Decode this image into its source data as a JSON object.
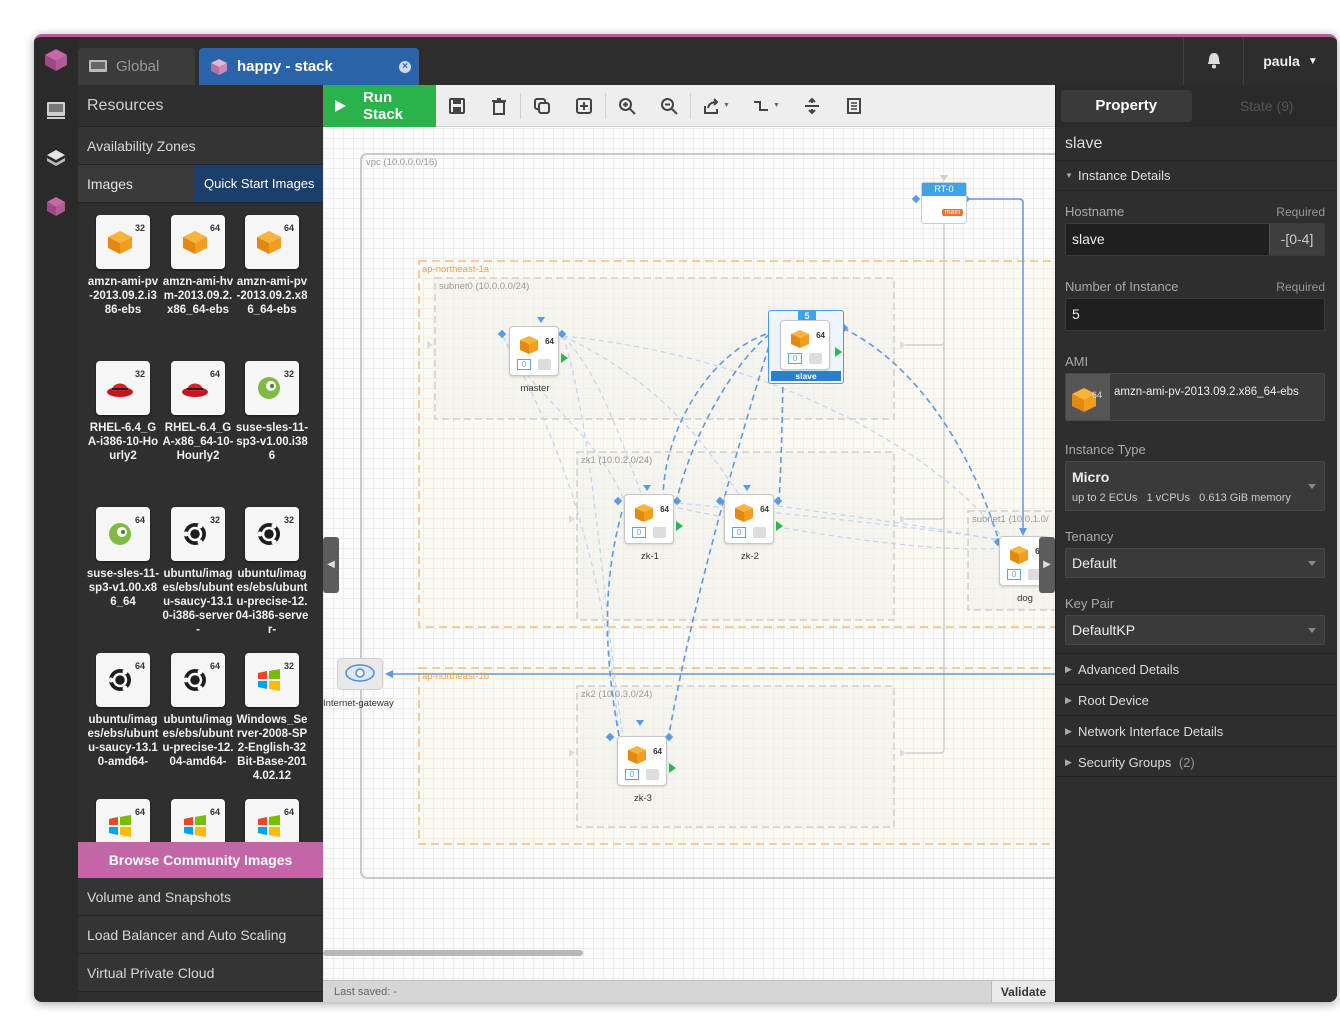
{
  "tabs": {
    "global": "Global",
    "stack": "happy - stack"
  },
  "user": {
    "name": "paula"
  },
  "resources": {
    "title": "Resources",
    "availability_zones": "Availability Zones",
    "images_tab": "Images",
    "quick_start": "Quick Start Images",
    "amis": [
      {
        "name": "amzn-ami-pv-2013.09.2.i386-ebs",
        "bits": "32",
        "icon": "amazon-box-icon"
      },
      {
        "name": "amzn-ami-hvm-2013.09.2.x86_64-ebs",
        "bits": "64",
        "icon": "amazon-box-icon"
      },
      {
        "name": "amzn-ami-pv-2013.09.2.x86_64-ebs",
        "bits": "64",
        "icon": "amazon-box-icon"
      },
      {
        "name": "RHEL-6.4_GA-i386-10-Hourly2",
        "bits": "32",
        "icon": "redhat-icon"
      },
      {
        "name": "RHEL-6.4_GA-x86_64-10-Hourly2",
        "bits": "64",
        "icon": "redhat-icon"
      },
      {
        "name": "suse-sles-11-sp3-v1.00.i386",
        "bits": "32",
        "icon": "suse-icon"
      },
      {
        "name": "suse-sles-11-sp3-v1.00.x86_64",
        "bits": "64",
        "icon": "suse-icon"
      },
      {
        "name": "ubuntu/images/ebs/ubuntu-saucy-13.10-i386-server-",
        "bits": "32",
        "icon": "ubuntu-icon"
      },
      {
        "name": "ubuntu/images/ebs/ubuntu-precise-12.04-i386-server-",
        "bits": "32",
        "icon": "ubuntu-icon"
      },
      {
        "name": "ubuntu/images/ebs/ubuntu-saucy-13.10-amd64-",
        "bits": "64",
        "icon": "ubuntu-icon"
      },
      {
        "name": "ubuntu/images/ebs/ubuntu-precise-12.04-amd64-",
        "bits": "64",
        "icon": "ubuntu-icon"
      },
      {
        "name": "Windows_Server-2008-SP2-English-32Bit-Base-2014.02.12",
        "bits": "32",
        "icon": "windows-icon"
      },
      {
        "name": "",
        "bits": "64",
        "icon": "windows-icon"
      },
      {
        "name": "",
        "bits": "64",
        "icon": "windows-icon"
      },
      {
        "name": "",
        "bits": "64",
        "icon": "windows-icon"
      }
    ],
    "browse_community": "Browse Community Images",
    "volume": "Volume and Snapshots",
    "load_balancer": "Load Balancer and Auto Scaling",
    "vpc": "Virtual Private Cloud"
  },
  "toolbar": {
    "run_stack": "Run Stack"
  },
  "diagram": {
    "vpc": "vpc (10.0.0.0/16)",
    "az_a": "ap-northeast-1a",
    "az_b": "ap-northeast-1b",
    "subnet0": "subnet0 (10.0.0.0/24)",
    "zk1": "zk1 (10.0.2.0/24)",
    "zk2": "zk2 (10.0.3.0/24)",
    "subnet1": "subnet1 (10.0.1.0/",
    "route_table": "RT-0",
    "route_main": "main",
    "igw": "Internet-gateway",
    "instances": {
      "master": "master",
      "slave": "slave",
      "slave_count": "5",
      "zk1": "zk-1",
      "zk2": "zk-2",
      "zk3": "zk-3",
      "dog": "dog",
      "bits": "64",
      "eni": "0"
    }
  },
  "status": {
    "last_saved": "Last saved: -",
    "validate": "Validate"
  },
  "properties": {
    "tab_property": "Property",
    "tab_state": "State (9)",
    "title": "slave",
    "instance_details": "Instance Details",
    "hostname_label": "Hostname",
    "required": "Required",
    "hostname": "slave",
    "hostname_suffix": "-[0-4]",
    "count_label": "Number of Instance",
    "count": "5",
    "ami_label": "AMI",
    "ami_value": "amzn-ami-pv-2013.09.2.x86_64-ebs",
    "ami_bits": "64",
    "type_label": "Instance Type",
    "type_value": "Micro",
    "type_ecus": "up to 2 ECUs",
    "type_vcpus": "1 vCPUs",
    "type_memory": "0.613 GiB memory",
    "tenancy_label": "Tenancy",
    "tenancy_value": "Default",
    "keypair_label": "Key Pair",
    "keypair_value": "DefaultKP",
    "advanced": "Advanced Details",
    "root_device": "Root Device",
    "network_interface": "Network Interface Details",
    "security_groups": "Security Groups",
    "security_groups_count": "(2)"
  },
  "colors": {
    "accent": "#b85aa3",
    "stack_tab": "#2a63a8",
    "run_stack": "#29b34a",
    "browse": "#c465a8",
    "connection": "#5a9be6"
  }
}
